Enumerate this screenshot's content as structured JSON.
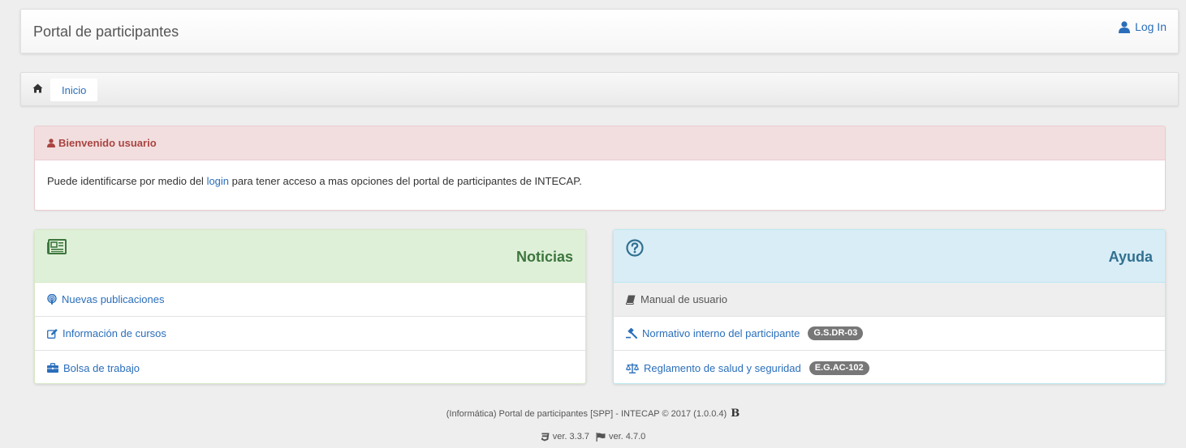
{
  "navbar": {
    "brand": "Portal de participantes",
    "login_label": "Log In"
  },
  "breadcrumb": {
    "items": [
      {
        "label": "Inicio"
      }
    ]
  },
  "welcome": {
    "title": "Bienvenido usuario",
    "text_before": "Puede identificarse por medio del ",
    "link": "login",
    "text_after": " para tener acceso a mas opciones del portal de participantes de INTECAP."
  },
  "news": {
    "title": "Noticias",
    "icon": "newspaper-icon",
    "items": [
      {
        "label": "Nuevas publicaciones",
        "icon": "podcast-icon"
      },
      {
        "label": "Información de cursos",
        "icon": "edit-icon"
      },
      {
        "label": "Bolsa de trabajo",
        "icon": "briefcase-icon"
      }
    ]
  },
  "help": {
    "title": "Ayuda",
    "icon": "question-circle-icon",
    "items": [
      {
        "label": "Manual de usuario",
        "icon": "book-icon",
        "disabled": true
      },
      {
        "label": "Normativo interno del participante",
        "icon": "gavel-icon",
        "badge": "G.S.DR-03"
      },
      {
        "label": "Reglamento de salud y seguridad",
        "icon": "balance-scale-icon",
        "badge": "E.G.AC-102"
      }
    ]
  },
  "footer": {
    "line1": "(Informática) Portal de participantes [SPP] - INTECAP © 2017 (1.0.0.4)",
    "bootstrap_mark": "B",
    "bootstrap_version": "ver. 3.3.7",
    "fontawesome_version": "ver. 4.7.0"
  },
  "colors": {
    "link": "#2a6ebb",
    "danger_text": "#a94442",
    "success_text": "#3c763d",
    "info_text": "#31708f",
    "badge": "#777777"
  }
}
